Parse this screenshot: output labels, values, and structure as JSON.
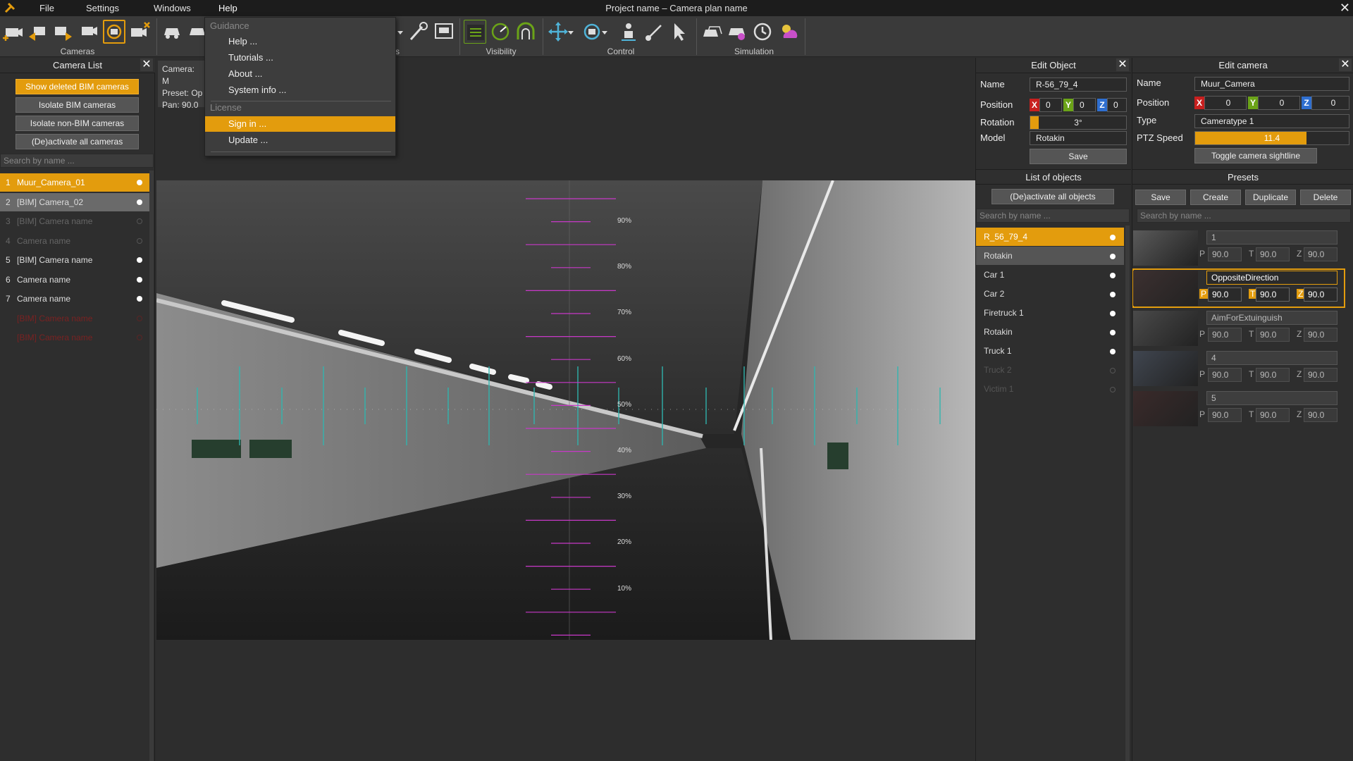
{
  "app": {
    "title": "Project name – Camera plan name"
  },
  "menu": {
    "file": "File",
    "settings": "Settings",
    "windows": "Windows",
    "help": "Help"
  },
  "help_menu": {
    "guidance_header": "Guidance",
    "help": "Help ...",
    "tutorials": "Tutorials ...",
    "about": "About ...",
    "system_info": "System info ...",
    "license_header": "License",
    "sign_in": "Sign in ...",
    "update": "Update ..."
  },
  "toolbar": {
    "groups": {
      "cameras": "Cameras",
      "visibility": "Visibility",
      "control": "Control",
      "simulation": "Simulation",
      "partial": "s"
    }
  },
  "camera_info": {
    "camera": "Camera: M",
    "preset": "Preset: Op",
    "pan": "Pan: 90.0"
  },
  "camera_list": {
    "title": "Camera List",
    "buttons": {
      "show_deleted": "Show deleted BIM cameras",
      "isolate_bim": "Isolate BIM cameras",
      "isolate_non_bim": "Isolate non-BIM cameras",
      "deactivate_all": "(De)activate all cameras"
    },
    "search_placeholder": "Search by name ...",
    "items": [
      {
        "num": "1",
        "name": "Muur_Camera_01",
        "state": "selected"
      },
      {
        "num": "2",
        "name": "[BIM] Camera_02",
        "state": "hover"
      },
      {
        "num": "3",
        "name": "[BIM] Camera name",
        "state": "inactive"
      },
      {
        "num": "4",
        "name": "Camera name",
        "state": "inactive"
      },
      {
        "num": "5",
        "name": "[BIM] Camera name",
        "state": "active"
      },
      {
        "num": "6",
        "name": "Camera name",
        "state": "active"
      },
      {
        "num": "7",
        "name": "Camera name",
        "state": "active"
      },
      {
        "num": "",
        "name": "[BIM] Camera name",
        "state": "deleted"
      },
      {
        "num": "",
        "name": "[BIM] Camera name",
        "state": "deleted"
      }
    ]
  },
  "viewport": {
    "tilt_labels": [
      "90%",
      "80%",
      "70%",
      "60%",
      "50%",
      "40%",
      "30%",
      "20%",
      "10%"
    ]
  },
  "edit_object": {
    "title": "Edit Object",
    "name_label": "Name",
    "name_value": "R-56_79_4",
    "position_label": "Position",
    "x": "0",
    "y": "0",
    "z": "0",
    "rotation_label": "Rotation",
    "rotation_value": "3°",
    "model_label": "Model",
    "model_value": "Rotakin",
    "save": "Save"
  },
  "objects": {
    "title": "List of objects",
    "deactivate_all": "(De)activate all objects",
    "search_placeholder": "Search by name ...",
    "items": [
      {
        "name": "R_56_79_4",
        "state": "selected"
      },
      {
        "name": "Rotakin",
        "state": "hover"
      },
      {
        "name": "Car 1",
        "state": "active"
      },
      {
        "name": "Car 2",
        "state": "active"
      },
      {
        "name": "Firetruck 1",
        "state": "active"
      },
      {
        "name": "Rotakin",
        "state": "active"
      },
      {
        "name": "Truck 1",
        "state": "active"
      },
      {
        "name": "Truck 2",
        "state": "inactive"
      },
      {
        "name": "Victim 1",
        "state": "inactive"
      }
    ]
  },
  "edit_camera": {
    "title": "Edit camera",
    "name_label": "Name",
    "name_value": "Muur_Camera",
    "position_label": "Position",
    "x": "0",
    "y": "0",
    "z": "0",
    "type_label": "Type",
    "type_value": "Cameratype 1",
    "ptz_label": "PTZ Speed",
    "ptz_value": "11.4",
    "toggle_sightline": "Toggle camera sightline"
  },
  "presets": {
    "title": "Presets",
    "save": "Save",
    "create": "Create",
    "duplicate": "Duplicate",
    "delete": "Delete",
    "search_placeholder": "Search by name ...",
    "p_label": "P",
    "t_label": "T",
    "z_label": "Z",
    "items": [
      {
        "name": "1",
        "p": "90.0",
        "t": "90.0",
        "z": "90.0"
      },
      {
        "name": "OppositeDirection",
        "p": "90.0",
        "t": "90.0",
        "z": "90.0"
      },
      {
        "name": "AimForExtuinguish",
        "p": "90.0",
        "t": "90.0",
        "z": "90.0"
      },
      {
        "name": "4",
        "p": "90.0",
        "t": "90.0",
        "z": "90.0"
      },
      {
        "name": "5",
        "p": "90.0",
        "t": "90.0",
        "z": "90.0"
      }
    ]
  },
  "colors": {
    "accent": "#e39c0d",
    "axis_x": "#c8201f",
    "axis_y": "#6ba318",
    "axis_z": "#2f6fd0",
    "deleted_text": "#7a2222"
  }
}
